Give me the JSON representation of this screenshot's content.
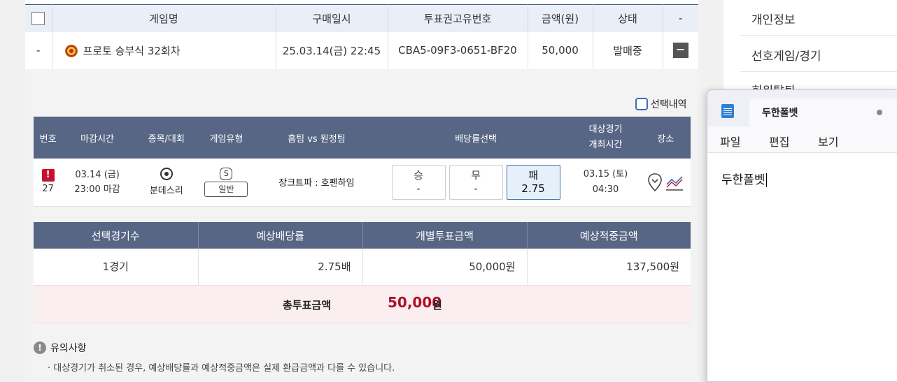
{
  "purchase_table": {
    "headers": [
      "게임명",
      "구매일시",
      "투표권고유번호",
      "금액(원)",
      "상태",
      "-"
    ],
    "row": {
      "index": "-",
      "game_name": "프로토 승부식 32회차",
      "purchase_date": "25.03.14(금) 22:45",
      "ticket_id": "CBA5-09F3-0651-BF20",
      "amount": "50,000",
      "status": "발매중",
      "toggle": "−"
    }
  },
  "selection_history_label": "선택내역",
  "game_table": {
    "headers": {
      "number": "번호",
      "deadline": "마감시간",
      "sport": "종목/대회",
      "game_type": "게임유형",
      "teams": "홈팀 vs 원정팀",
      "odds": "배당률선택",
      "match_time_line1": "대상경기",
      "match_time_line2": "개최시간",
      "venue": "장소"
    },
    "row": {
      "warn": "!",
      "number": "27",
      "deadline_date": "03.14 (금)",
      "deadline_time": "23:00 마감",
      "sport": "분데스리",
      "type_letter": "S",
      "type_badge": "일반",
      "teams": "장크트파 : 호펜하임",
      "odds": [
        {
          "label": "승",
          "value": "-"
        },
        {
          "label": "무",
          "value": "-"
        },
        {
          "label": "패",
          "value": "2.75"
        }
      ],
      "match_date": "03.15 (토)",
      "match_time": "04:30"
    }
  },
  "summary_table": {
    "headers": [
      "선택경기수",
      "예상배당률",
      "개별투표금액",
      "예상적중금액"
    ],
    "values": [
      "1경기",
      "2.75배",
      "50,000원",
      "137,500원"
    ],
    "total_label": "총투표금액",
    "total_value": "50,000",
    "total_unit": "원"
  },
  "notice": {
    "title": "유의사항",
    "text": "· 대상경기가 취소된 경우, 예상배당률과 예상적중금액은 실제 환급금액과 다를 수 있습니다."
  },
  "right_menu": {
    "items": [
      "개인정보",
      "선호게임/경기",
      "회원탈퇴"
    ]
  },
  "notepad": {
    "tab_title": "두한폴벳",
    "menus": [
      "파일",
      "편집",
      "보기"
    ],
    "content": "두한폴벳"
  },
  "colors": {
    "header_navy": "#586685",
    "accent_red": "#b0102a",
    "total_bg": "#fbeef0"
  }
}
